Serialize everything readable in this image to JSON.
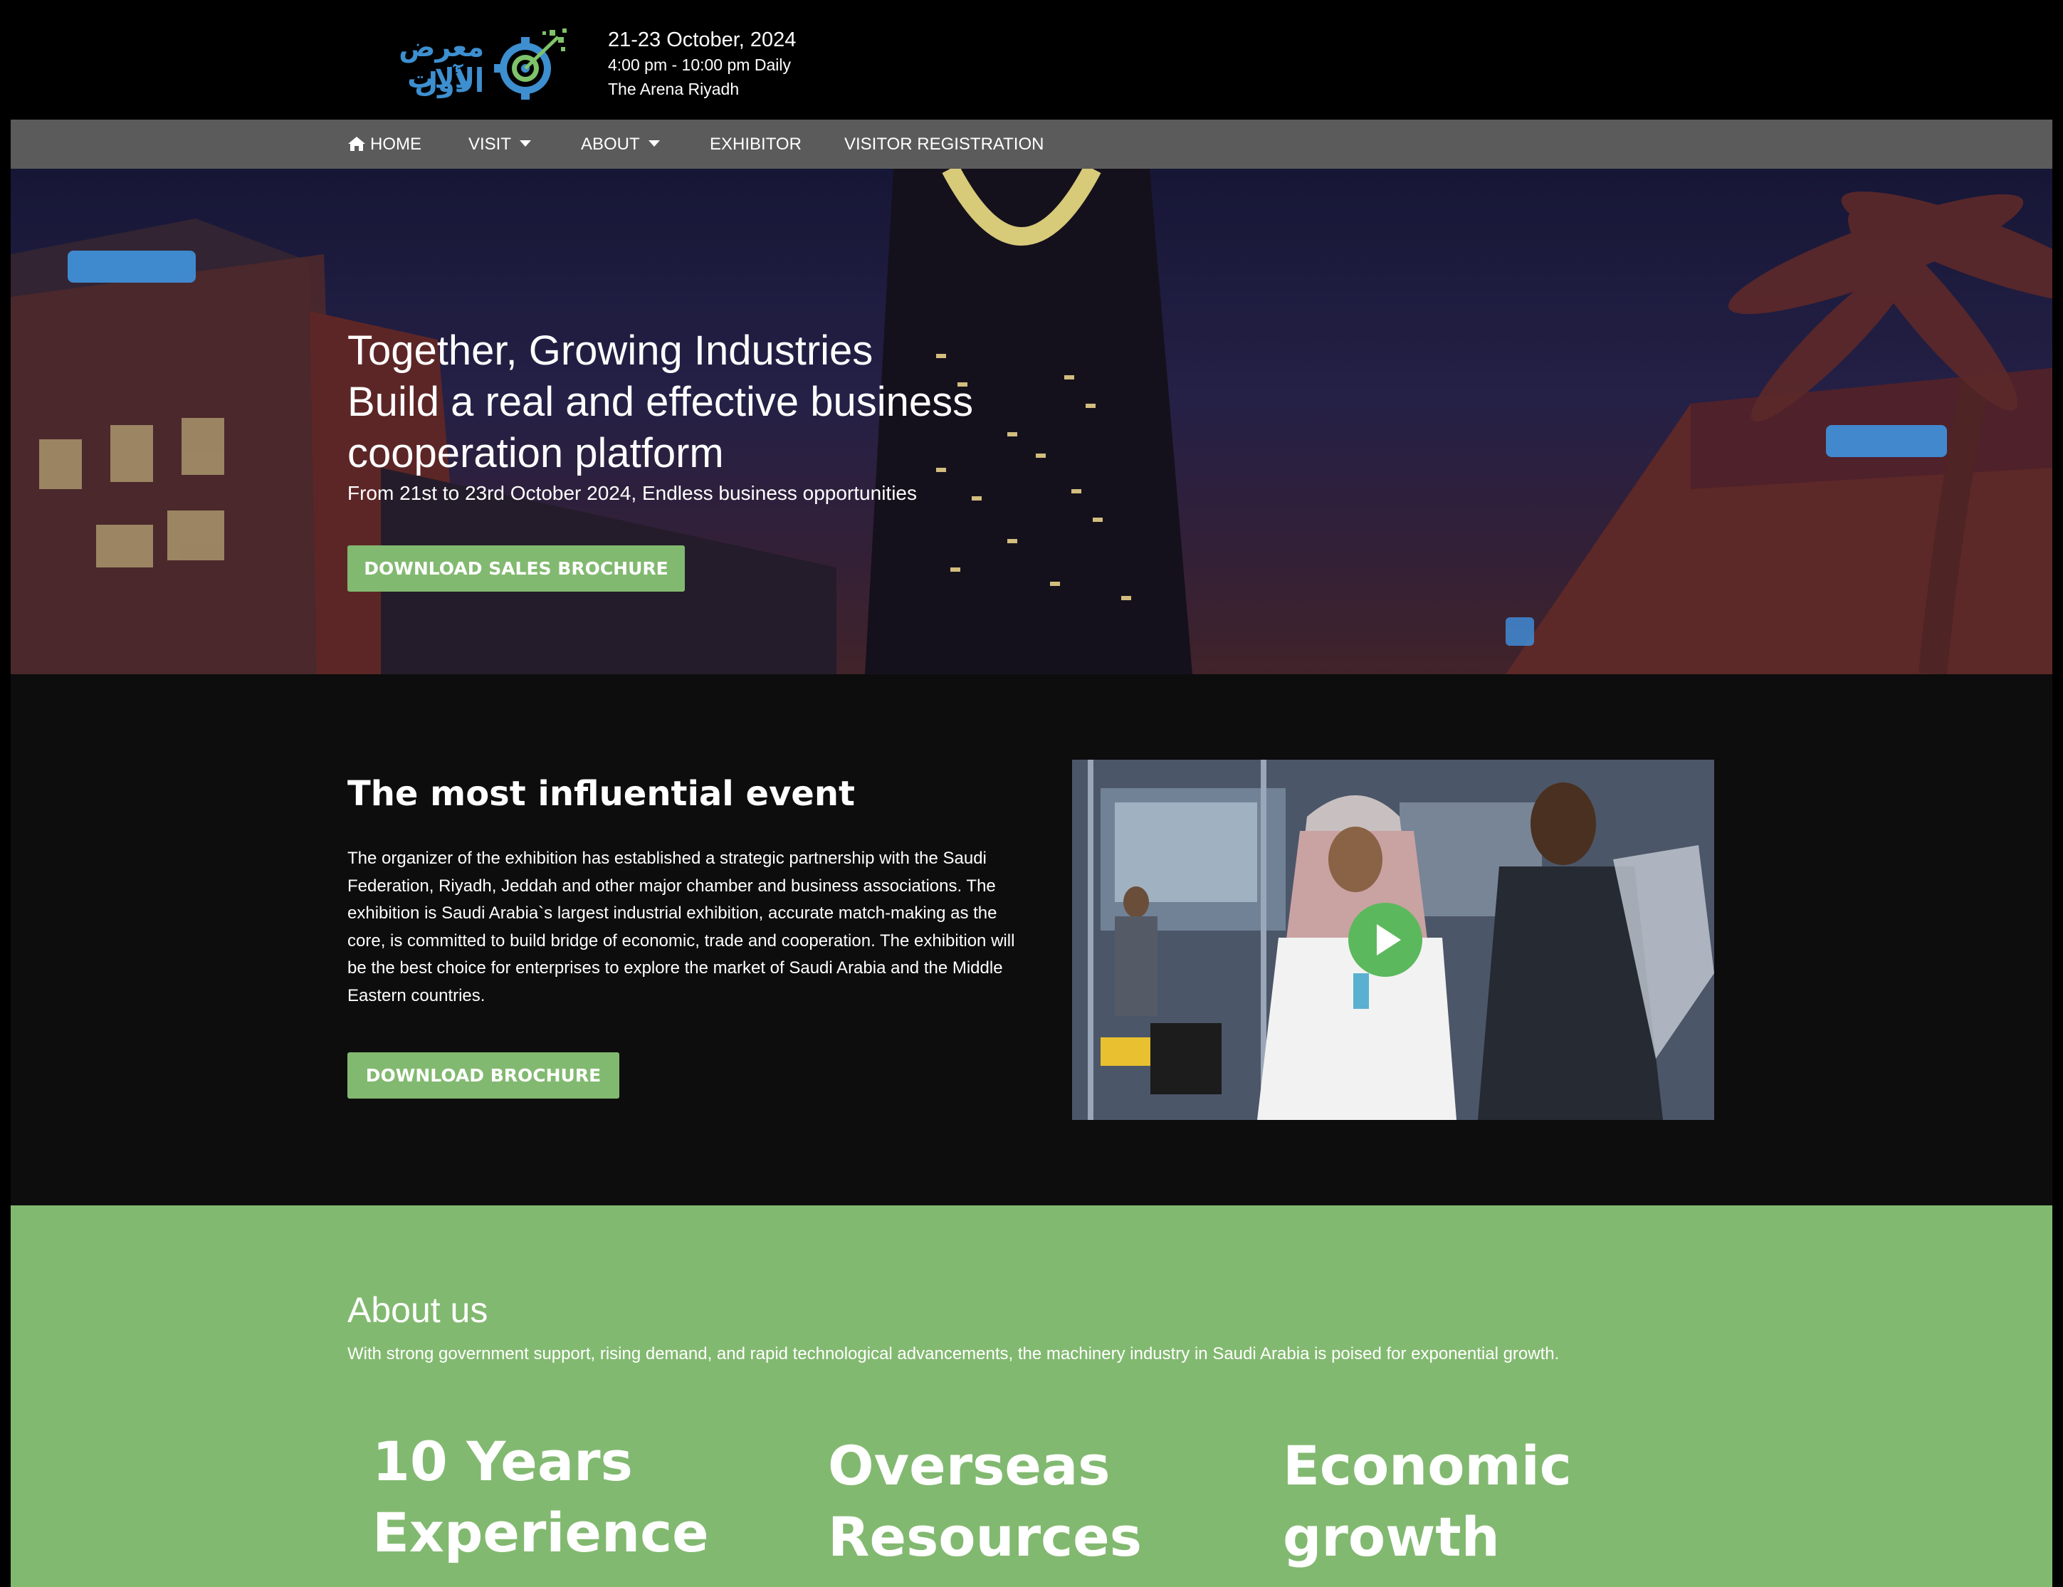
{
  "header": {
    "logo_ar_line1": "معرض الآلات",
    "logo_ar_line2": "الأول",
    "dates": "21-23 October, 2024",
    "hours": "4:00 pm - 10:00 pm Daily",
    "venue": "The Arena Riyadh"
  },
  "nav": {
    "items": [
      {
        "label": "HOME",
        "icon": "home-icon"
      },
      {
        "label": "VISIT",
        "dropdown": true
      },
      {
        "label": "ABOUT",
        "dropdown": true
      },
      {
        "label": "EXHIBITOR"
      },
      {
        "label": "VISITOR REGISTRATION"
      }
    ]
  },
  "hero": {
    "title_lines": [
      "Together, Growing Industries",
      "Build a real and effective business",
      "cooperation platform"
    ],
    "subtitle": "From 21st to 23rd October 2024, Endless business opportunities",
    "button_label": "DOWNLOAD SALES BROCHURE"
  },
  "event": {
    "heading": "The most influential event",
    "body": "The organizer of the exhibition has established a strategic partnership with the Saudi Federation, Riyadh, Jeddah and other major chamber and business associations. The exhibition is Saudi Arabia`s largest industrial exhibition, accurate match-making as the core, is committed to build bridge of economic, trade and cooperation. The exhibition will be the best choice for enterprises to explore the market of Saudi Arabia and the Middle Eastern countries.",
    "button_label": "DOWNLOAD BROCHURE",
    "video_icon": "play-icon"
  },
  "about": {
    "title": "About us",
    "description": "With strong government support, rising demand, and rapid technological advancements, the machinery industry in Saudi Arabia is poised for exponential growth.",
    "features": [
      {
        "line1": "10 Years",
        "line2": "Experience"
      },
      {
        "line1": "Overseas",
        "line2": "Resources"
      },
      {
        "line1": "Economic",
        "line2": "growth"
      }
    ]
  },
  "colors": {
    "accent_green": "#82b970",
    "nav_bg": "#5b5b5b",
    "logo_blue": "#3d8fd0",
    "page_bg": "#000000"
  }
}
